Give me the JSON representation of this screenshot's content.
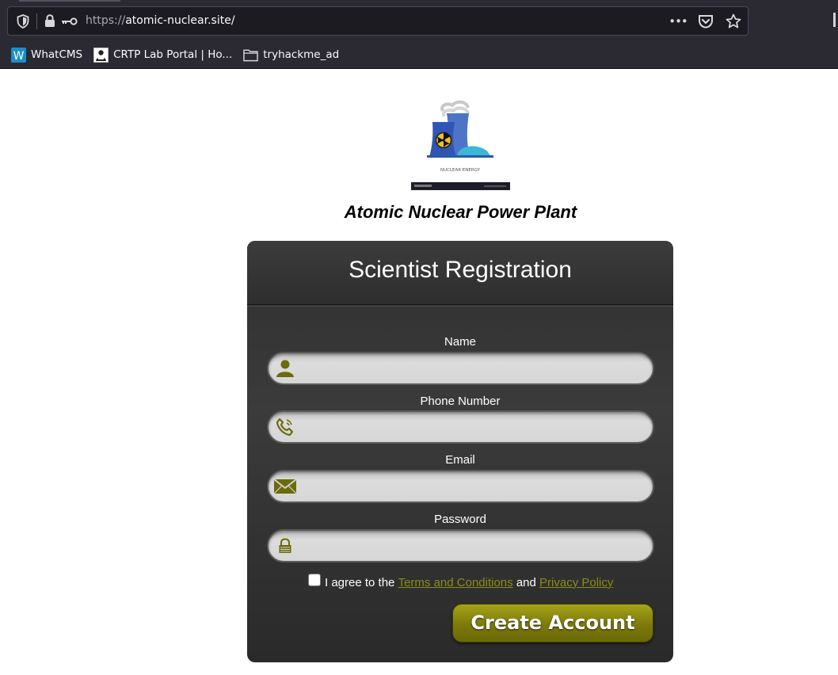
{
  "browser": {
    "url_protocol": "https://",
    "url_host": "atomic-nuclear.site/",
    "bookmarks": [
      {
        "label": "WhatCMS",
        "icon": "whatcms-w-icon"
      },
      {
        "label": "CRTP Lab Portal | Ho...",
        "icon": "crtp-portal-icon"
      },
      {
        "label": "tryhackme_ad",
        "icon": "folder-icon"
      }
    ],
    "more_menu": "•••"
  },
  "page": {
    "logo_caption": "NUCLEAR ENERGY",
    "site_title": "Atomic Nuclear Power Plant",
    "form": {
      "title": "Scientist Registration",
      "fields": [
        {
          "label": "Name",
          "value": "",
          "icon": "person-icon"
        },
        {
          "label": "Phone Number",
          "value": "",
          "icon": "phone-icon"
        },
        {
          "label": "Email",
          "value": "",
          "icon": "envelope-icon"
        },
        {
          "label": "Password",
          "value": "",
          "icon": "lock-icon"
        }
      ],
      "agree_prefix": "I agree to the ",
      "terms_link": "Terms and Conditions",
      "agree_middle": " and ",
      "privacy_link": "Privacy Policy",
      "submit_label": "Create Account"
    }
  },
  "colors": {
    "accent_olive": "#8c8c14",
    "card_bg": "#333333",
    "chrome_bg": "#2b2a33"
  }
}
